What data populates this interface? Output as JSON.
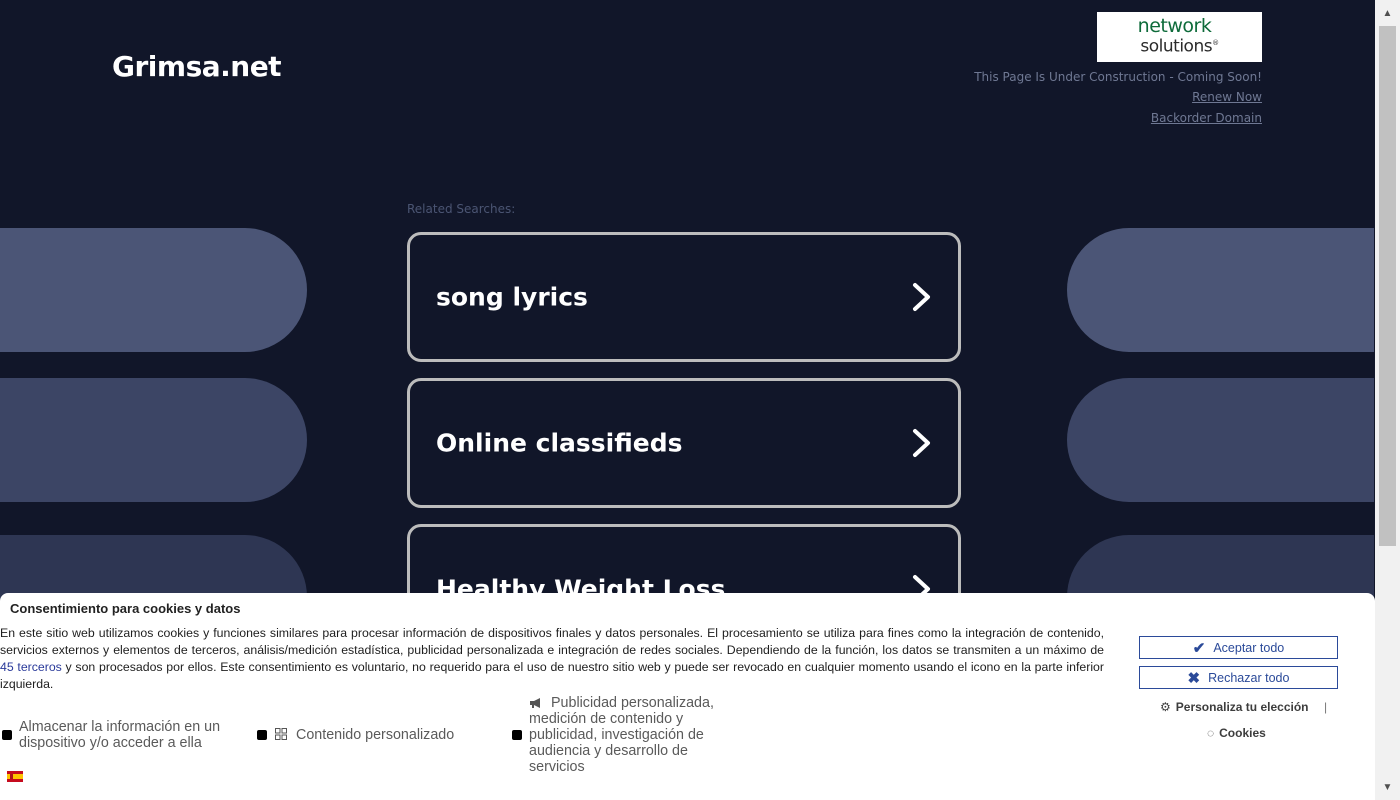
{
  "site": {
    "title": "Grimsa.net"
  },
  "brand": {
    "line1": "network",
    "line2": "solutions",
    "registered_mark": "®"
  },
  "header_links": {
    "under_construction": "This Page Is Under Construction - Coming Soon!",
    "renew": "Renew Now",
    "backorder": "Backorder Domain"
  },
  "related": {
    "label": "Related Searches:",
    "items": [
      {
        "label": "song lyrics"
      },
      {
        "label": "Online classifieds"
      },
      {
        "label": "Healthy Weight Loss"
      }
    ]
  },
  "consent": {
    "title": "Consentimiento para cookies y datos",
    "text_before_link": "En este sitio web utilizamos cookies y funciones similares para procesar información de dispositivos finales y datos personales. El procesamiento se utiliza para fines como la integración de contenido, servicios externos y elementos de terceros, análisis/medición estadística, publicidad personalizada e integración de redes sociales. Dependiendo de la función, los datos se transmiten a un máximo de ",
    "link_text": "45 terceros",
    "text_after_link": " y son procesados por ellos. Este consentimiento es voluntario, no requerido para el uso de nuestro sitio web y puede ser revocado en cualquier momento usando el icono en la parte inferior izquierda.",
    "options": [
      {
        "label": "Almacenar la información en un dispositivo y/o acceder a ella"
      },
      {
        "label": "Contenido personalizado"
      },
      {
        "label": "Publicidad personalizada, medición de contenido y publicidad, investigación de audiencia y desarrollo de servicios"
      }
    ],
    "accept_label": "Aceptar todo",
    "reject_label": "Rechazar todo",
    "customize_label": "Personaliza tu elección",
    "separator": "|",
    "cookies_label": "Cookies"
  },
  "colors": {
    "background": "#111629",
    "pill": "#4b5576",
    "card_border": "#bcbcbc",
    "button_blue": "#2b4a99",
    "brand_green": "#0e6b3a"
  }
}
